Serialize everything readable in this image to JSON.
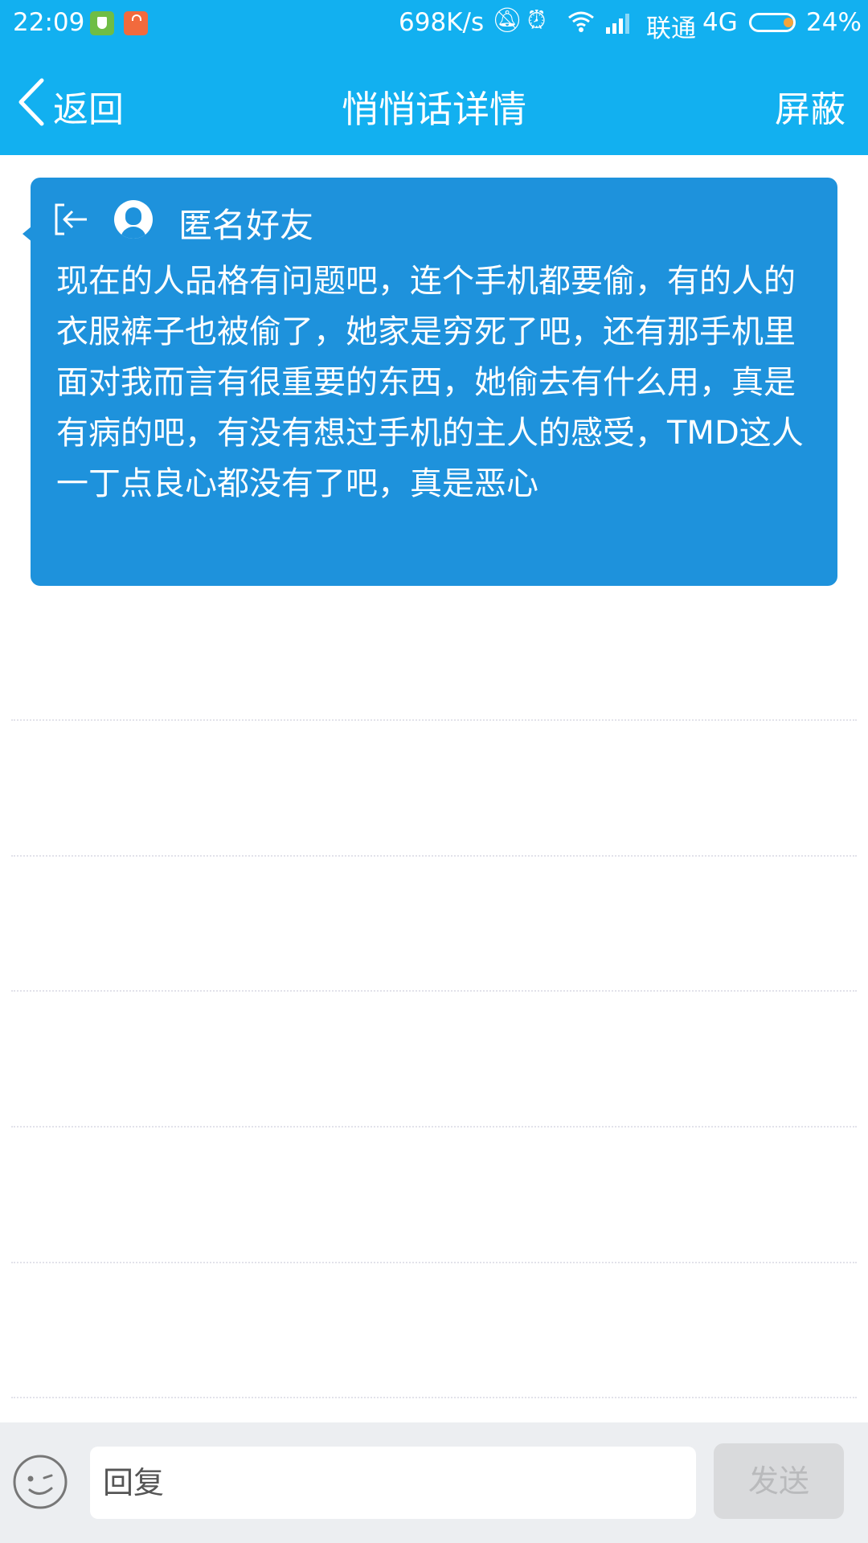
{
  "status_bar": {
    "time": "22:09",
    "net_speed": "698K/s",
    "carrier": "联通",
    "network": "4G",
    "battery": "24%",
    "icons": [
      "shield-app-icon",
      "shopping-bag-app-icon",
      "mute-bell-icon",
      "alarm-icon",
      "wifi-icon",
      "signal-icon",
      "battery-icon"
    ]
  },
  "nav": {
    "back_label": "返回",
    "title": "悄悄话详情",
    "block_label": "屏蔽"
  },
  "message": {
    "sender": "匿名好友",
    "text": "现在的人品格有问题吧，连个手机都要偷，有的人的衣服裤子也被偷了，她家是穷死了吧，还有那手机里面对我而言有很重要的东西，她偷去有什么用，真是有病的吧，有没有想过手机的主人的感受，TMD这人一丁点良心都没有了吧，真是恶心"
  },
  "reply": {
    "placeholder": "回复",
    "value": "",
    "send_label": "发送"
  },
  "colors": {
    "header_bg": "#12b0f0",
    "bubble_bg": "#1e92dc",
    "reply_bar_bg": "#eceef1",
    "send_disabled_bg": "#d9dadc"
  }
}
